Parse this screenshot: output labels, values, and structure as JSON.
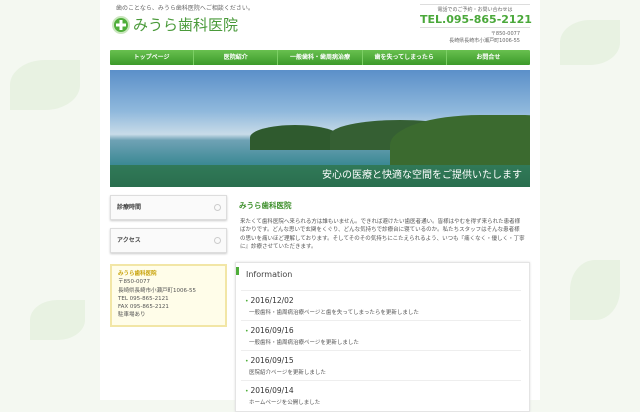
{
  "header": {
    "tagline": "歯のことなら、みうら歯科医院へご相談ください。",
    "logo": "みうら歯科医院",
    "contact_label": "電話でのご予約・お問い合わせは",
    "tel": "TEL.095-865-2121",
    "postal": "〒850-0077",
    "address": "長崎県長崎市小瀬戸町1006-55"
  },
  "nav": [
    {
      "label": "トップページ"
    },
    {
      "label": "医院紹介"
    },
    {
      "label": "一般歯科・歯周病治療"
    },
    {
      "label": "歯を失ってしまったら"
    },
    {
      "label": "お問合せ"
    }
  ],
  "hero": {
    "caption": "安心の医療と快適な空間をご提供いたします"
  },
  "sidebar": {
    "items": [
      {
        "label": "診療時間"
      },
      {
        "label": "アクセス"
      }
    ],
    "address_box": {
      "name": "みうら歯科医院",
      "postal": "〒850-0077",
      "address": "長崎県長崎市小瀬戸町1006-55",
      "tel": "TEL 095-865-2121",
      "fax": "FAX 095-865-2121",
      "parking": "駐車場あり"
    }
  },
  "main": {
    "title": "みうら歯科医院",
    "text": "来たくて歯科医院へ来られる方は誰もいません。できれば避けたい歯医者通い。皆様はやむを得ず来られた患者様ばかりです。どんな思いで玄関をくぐり、どんな気持ちで診療台に寝ているのか。私たちスタッフはそんな患者様の思いを痛いほど理解しております。そしてそのその気持ちにこたえられるよう、いつも『痛くなく・優しく・丁寧に』診療させていただきます。",
    "info": {
      "title": "Information",
      "items": [
        {
          "date": "2016/12/02",
          "text": "一般歯科・歯周病治療ページと歯を失ってしまったらを更新しました"
        },
        {
          "date": "2016/09/16",
          "text": "一般歯科・歯周病治療ページを更新しました"
        },
        {
          "date": "2016/09/15",
          "text": "医院紹介ページを更新しました"
        },
        {
          "date": "2016/09/14",
          "text": "ホームページを公開しました"
        }
      ]
    }
  }
}
